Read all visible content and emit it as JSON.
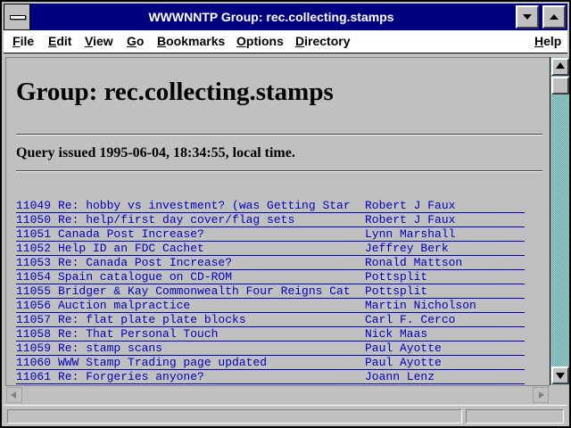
{
  "window": {
    "title": "WWWNNTP Group: rec.collecting.stamps"
  },
  "menu": {
    "items": [
      "File",
      "Edit",
      "View",
      "Go",
      "Bookmarks",
      "Options",
      "Directory"
    ],
    "help": "Help"
  },
  "page": {
    "heading": "Group: rec.collecting.stamps",
    "query_text": "Query issued 1995-06-04, 18:34:55, local time."
  },
  "articles": [
    {
      "num": "11049",
      "subject": "Re: hobby vs investment? (was Getting Star",
      "author": "Robert J Faux"
    },
    {
      "num": "11050",
      "subject": "Re: help/first day cover/flag sets",
      "author": "Robert J Faux"
    },
    {
      "num": "11051",
      "subject": "Canada Post Increase?",
      "author": "Lynn Marshall"
    },
    {
      "num": "11052",
      "subject": "Help ID an FDC Cachet",
      "author": "Jeffrey Berk"
    },
    {
      "num": "11053",
      "subject": "Re: Canada Post Increase?",
      "author": "Ronald Mattson"
    },
    {
      "num": "11054",
      "subject": "Spain catalogue on CD-ROM",
      "author": "Pottsplit"
    },
    {
      "num": "11055",
      "subject": "Bridger & Kay Commonwealth Four Reigns Cat",
      "author": "Pottsplit"
    },
    {
      "num": "11056",
      "subject": "Auction malpractice",
      "author": "Martin Nicholson"
    },
    {
      "num": "11057",
      "subject": "Re: flat plate plate blocks",
      "author": "Carl F. Cerco"
    },
    {
      "num": "11058",
      "subject": "Re: That Personal Touch",
      "author": "Nick Maas"
    },
    {
      "num": "11059",
      "subject": "Re: stamp scans",
      "author": "Paul Ayotte"
    },
    {
      "num": "11060",
      "subject": "WWW Stamp Trading page updated",
      "author": "Paul Ayotte"
    },
    {
      "num": "11061",
      "subject": "Re: Forgeries anyone?",
      "author": "Joann Lenz"
    }
  ],
  "icons": {
    "system_menu": "system-menu-icon",
    "minimize": "minimize-icon",
    "maximize": "maximize-icon",
    "scroll_up": "arrow-up-icon",
    "scroll_down": "arrow-down-icon",
    "scroll_left": "arrow-left-icon",
    "scroll_right": "arrow-right-icon"
  },
  "colors": {
    "titlebar": "#000080",
    "link": "#0000c0",
    "background": "#c0c0c0"
  }
}
